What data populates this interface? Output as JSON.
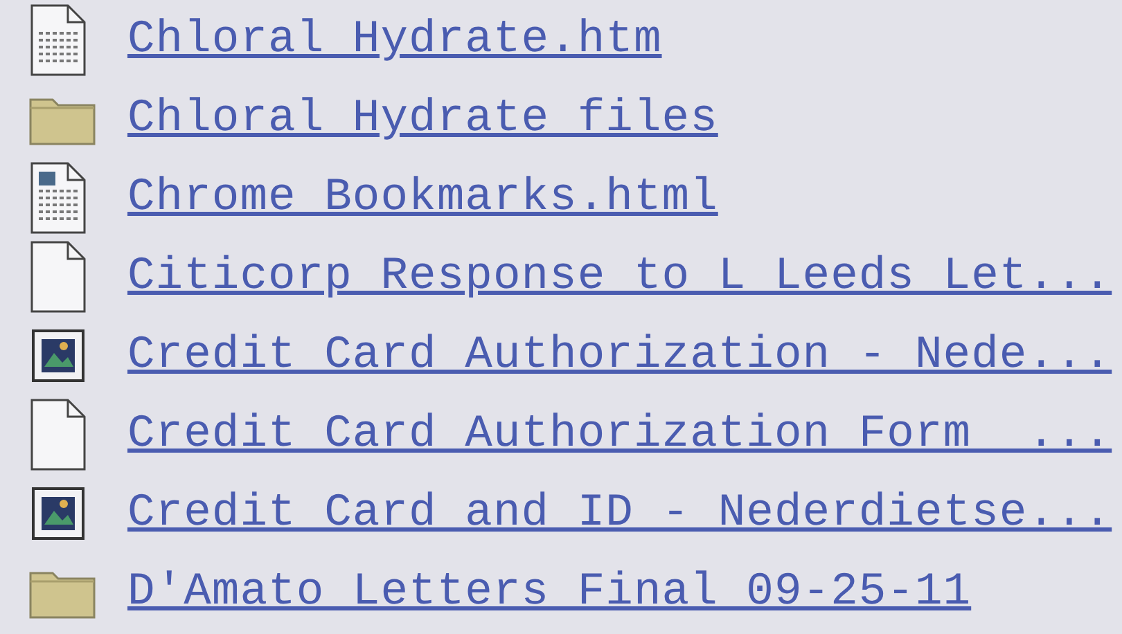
{
  "files": [
    {
      "kind": "page",
      "name": "Chloral Hydrate.htm"
    },
    {
      "kind": "folder",
      "name": "Chloral Hydrate_files"
    },
    {
      "kind": "web-page",
      "name": "Chrome Bookmarks.html"
    },
    {
      "kind": "blank",
      "name": "Citicorp Response to L Leeds Let..."
    },
    {
      "kind": "image",
      "name": "Credit Card Authorization - Nede..."
    },
    {
      "kind": "blank",
      "name": "Credit Card Authorization Form  ..."
    },
    {
      "kind": "image",
      "name": "Credit Card and ID - Nederdietse..."
    },
    {
      "kind": "folder",
      "name": "D'Amato Letters Final 09-25-11"
    }
  ]
}
